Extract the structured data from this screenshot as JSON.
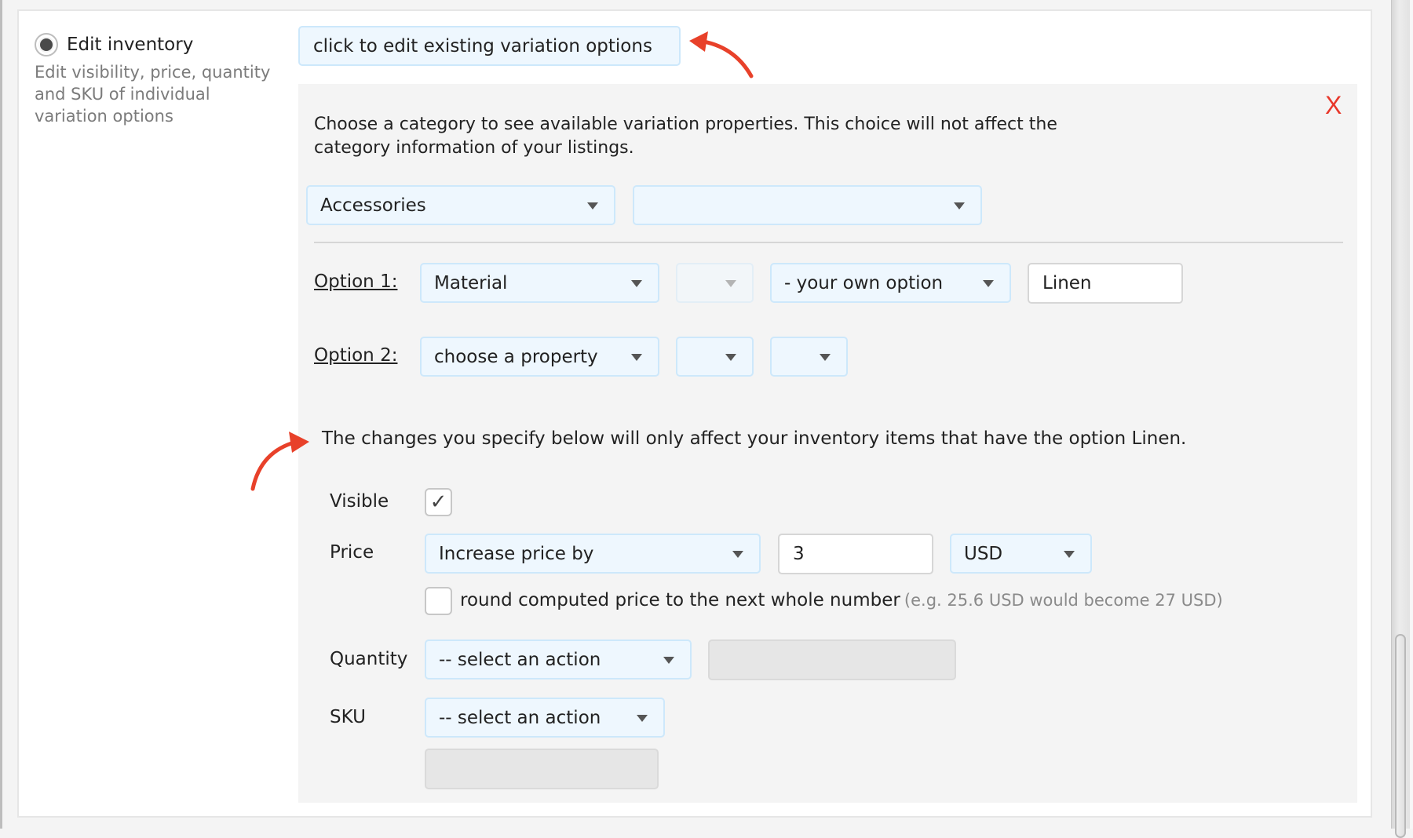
{
  "option": {
    "label": "Edit inventory",
    "description": "Edit visibility, price, quantity and SKU of individual variation options",
    "selected": true
  },
  "edit_button": {
    "label": "click to edit existing variation options"
  },
  "close": {
    "label": "X"
  },
  "intro": "Choose a category to see available variation properties. This choice will not affect the category information of your listings.",
  "category": {
    "primary": "Accessories",
    "secondary": ""
  },
  "options": [
    {
      "label": "Option 1:",
      "property": "Material",
      "scale": "",
      "value_select": "- your own option",
      "value_input": "Linen"
    },
    {
      "label": "Option 2:",
      "property": "choose a property",
      "scale": "",
      "value_select": ""
    }
  ],
  "note": "The changes you specify below will only affect your inventory items that have the option Linen.",
  "fields": {
    "visible": {
      "label": "Visible",
      "checked": true,
      "check_glyph": "✓"
    },
    "price": {
      "label": "Price",
      "action": "Increase price by",
      "amount": "3",
      "currency": "USD",
      "round_label": "round computed price to the next whole number",
      "round_hint": "(e.g. 25.6 USD would become 27 USD)",
      "round_checked": false
    },
    "quantity": {
      "label": "Quantity",
      "action": "-- select an action",
      "value": ""
    },
    "sku": {
      "label": "SKU",
      "action": "-- select an action",
      "value": ""
    }
  },
  "colors": {
    "accent_red": "#e8412a",
    "select_bg": "#eef7fe",
    "select_border": "#cde8fb"
  }
}
